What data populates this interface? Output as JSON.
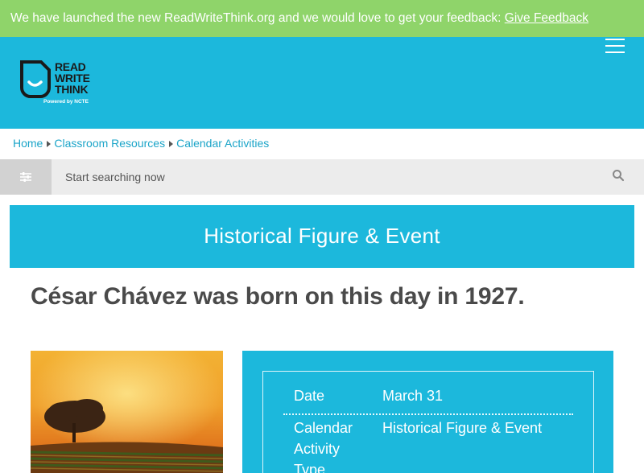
{
  "banner": {
    "message": "We have launched the new ReadWriteThink.org and we would love to get your feedback:",
    "link_label": "Give Feedback"
  },
  "header": {
    "logo": {
      "line1": "READ",
      "line2": "WRITE",
      "line3": "THINK",
      "tagline": "Powered by NCTE"
    },
    "menu_icon": "hamburger-icon"
  },
  "breadcrumb": {
    "items": [
      "Home",
      "Classroom Resources",
      "Calendar Activities"
    ]
  },
  "search": {
    "placeholder": "Start searching now",
    "filter_icon": "sliders-icon",
    "search_icon": "magnifier-icon"
  },
  "category_heading": "Historical Figure & Event",
  "title": "César Chávez was born on this day in 1927.",
  "details": [
    {
      "label": "Date",
      "value": "March 31"
    },
    {
      "label": "Calendar Activity Type",
      "value": "Historical Figure & Event"
    }
  ],
  "colors": {
    "banner": "#8fd46a",
    "brand_blue": "#1cb8dc",
    "link": "#1aa4c8",
    "title_text": "#4a4a4a"
  }
}
